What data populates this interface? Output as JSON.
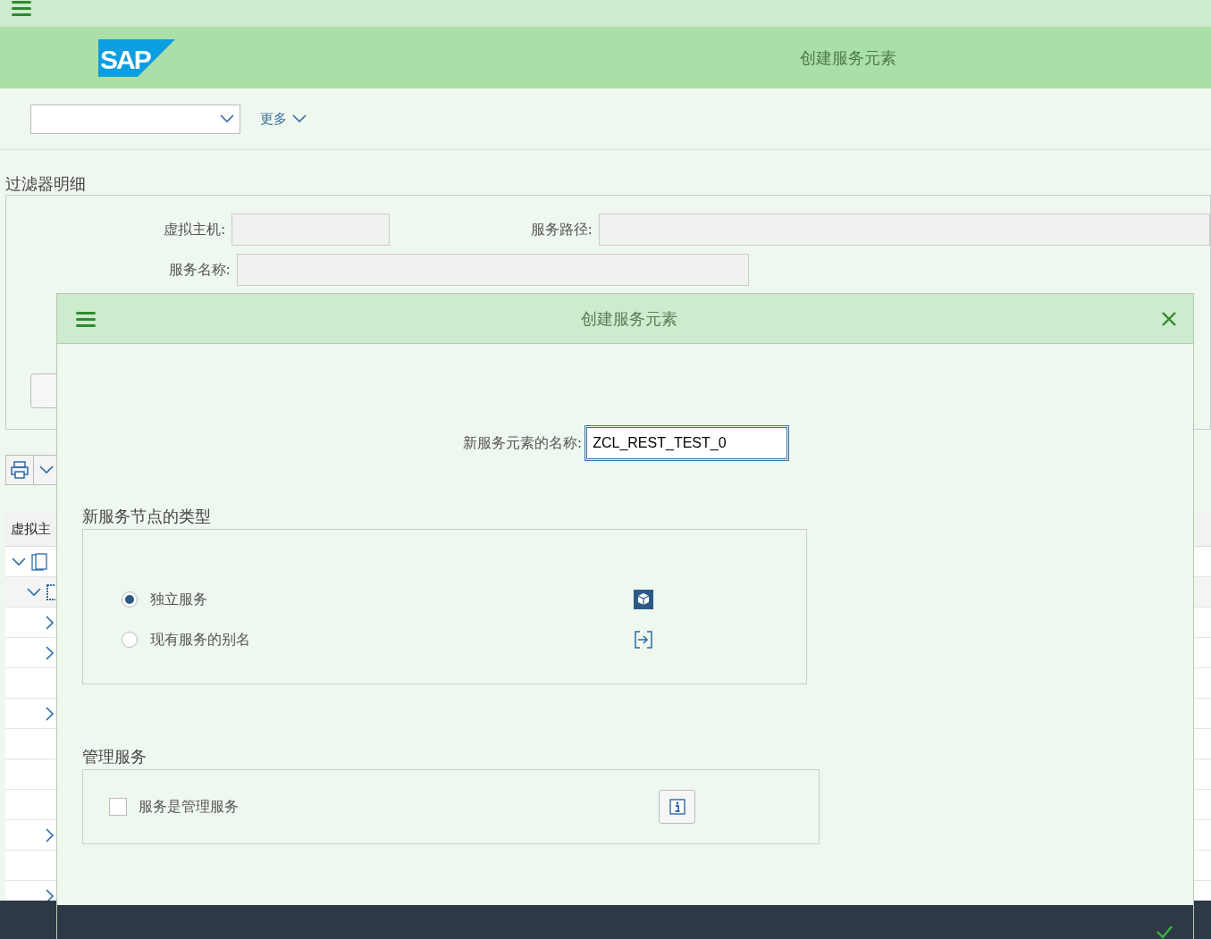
{
  "shell": {
    "logo": "SAP",
    "title": "创建服务元素"
  },
  "toolbar": {
    "more": "更多"
  },
  "filter": {
    "title": "过滤器明细",
    "fields": [
      {
        "label": "虚拟主机:"
      },
      {
        "label": "服务路径:"
      },
      {
        "label": "服务名称:"
      }
    ]
  },
  "tree": {
    "column_1": "虚拟主",
    "rows": [
      {
        "expanded": true,
        "children": [
          {
            "expanded": true,
            "children": [
              {
                "has_children": true
              },
              {
                "has_children": true
              },
              {
                "has_children": false
              },
              {
                "has_children": true
              },
              {
                "has_children": false
              },
              {
                "has_children": false
              },
              {
                "has_children": false
              },
              {
                "has_children": true
              },
              {
                "has_children": false
              },
              {
                "has_children": true
              }
            ]
          }
        ]
      }
    ]
  },
  "dialog": {
    "title": "创建服务元素",
    "name_label": "新服务元素的名称:",
    "name_value": "ZCL_REST_TEST_0",
    "type_group": {
      "title": "新服务节点的类型",
      "options": [
        {
          "label": "独立服务",
          "selected": true,
          "kind": "standalone"
        },
        {
          "label": "现有服务的别名",
          "selected": false,
          "kind": "alias"
        }
      ]
    },
    "admin_group": {
      "title": "管理服务",
      "checkbox": {
        "label": "服务是管理服务",
        "checked": false
      }
    }
  }
}
